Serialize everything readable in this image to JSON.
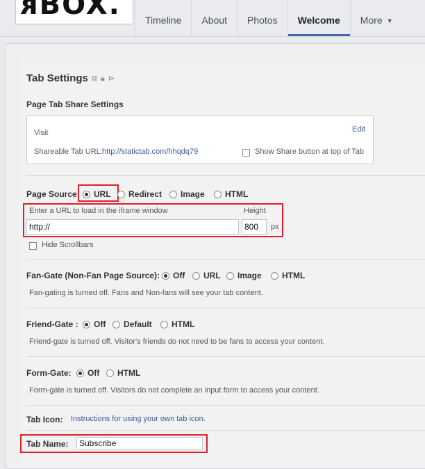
{
  "logo": {
    "text": "ᴙBOX."
  },
  "nav": {
    "items": [
      {
        "label": "Timeline",
        "active": false
      },
      {
        "label": "About",
        "active": false
      },
      {
        "label": "Photos",
        "active": false
      },
      {
        "label": "Welcome",
        "active": true
      },
      {
        "label": "More",
        "active": false
      }
    ],
    "more_caret": "▼"
  },
  "tab_settings": {
    "title": "Tab Settings",
    "share": {
      "section_title": "Page Tab Share Settings",
      "visit_label": "Visit",
      "edit_label": "Edit",
      "shareable_label": "Shareable Tab URL:",
      "shareable_url": "http://statictab.com/hhqdq79",
      "show_share_label": "Show Share button at top of Tab",
      "show_share_checked": false
    },
    "page_source": {
      "label": "Page Source:",
      "options": [
        "URL",
        "Redirect",
        "Image",
        "HTML"
      ],
      "selected": "URL",
      "url_hint": "Enter a URL to load in the iframe window",
      "url_value": "http://",
      "height_label": "Height",
      "height_value": "800",
      "height_unit": "px",
      "hide_scrollbars_label": "Hide Scrollbars",
      "hide_scrollbars_checked": false
    },
    "fan_gate": {
      "label": "Fan-Gate (Non-Fan Page Source):",
      "options": [
        "Off",
        "URL",
        "Image",
        "HTML"
      ],
      "selected": "Off",
      "description": "Fan-gating is turned off. Fans and Non-fans will see your tab content."
    },
    "friend_gate": {
      "label": "Friend-Gate :",
      "options": [
        "Off",
        "Default",
        "HTML"
      ],
      "selected": "Off",
      "description": "Friend-gate is turned off. Visitor's friends do not need to be fans to access your content."
    },
    "form_gate": {
      "label": "Form-Gate:",
      "options": [
        "Off",
        "HTML"
      ],
      "selected": "Off",
      "description": "Form-gate is turned off. Visitors do not complete an input form to access your content."
    },
    "tab_icon": {
      "label": "Tab Icon:",
      "link": "Instructions for using your own tab icon."
    },
    "tab_name": {
      "label": "Tab Name:",
      "value": "Subscribe"
    }
  },
  "colors": {
    "highlight": "#e0202a",
    "link": "#3b5998",
    "nav_active": "#4267b2"
  }
}
